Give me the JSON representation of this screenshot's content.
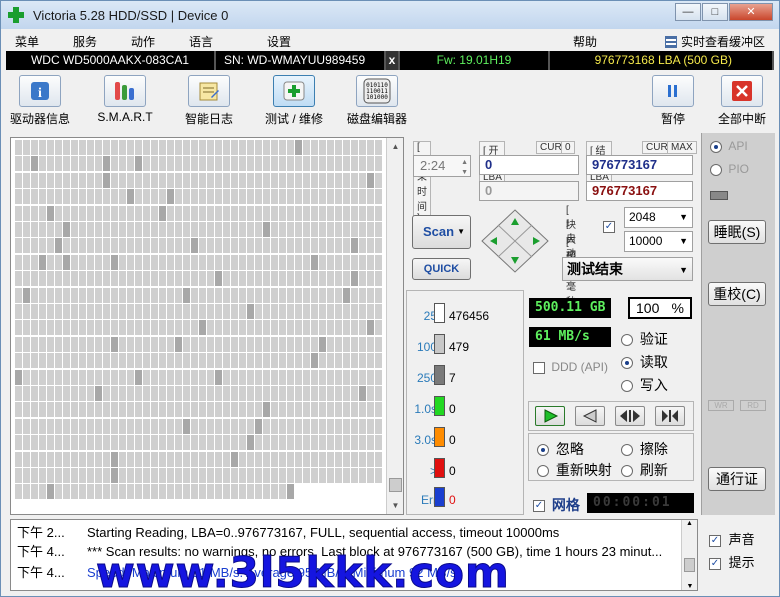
{
  "titlebar": {
    "title": "Victoria 5.28 HDD/SSD | Device 0",
    "min": "—",
    "max": "□",
    "close": "✕"
  },
  "menu": {
    "items": [
      "菜单",
      "服务",
      "动作",
      "语言",
      "设置",
      "帮助"
    ],
    "realtime": "实时查看缓冲区"
  },
  "device": {
    "model": "WDC WD5000AAKX-083CA1",
    "serial": "SN: WD-WMAYUU989459",
    "x": "x",
    "firmware": "Fw: 19.01H19",
    "lba": "976773168 LBA (500 GB)"
  },
  "toolbar": {
    "drivers": "驱动器信息",
    "smart": "S.M.A.R.T",
    "log": "智能日志",
    "test": "测试 / 维修",
    "hex": "磁盘编辑器",
    "pause": "暂停",
    "stop": "全部中断"
  },
  "controls": {
    "end_time_label": "[ 结束时间 ]",
    "end_time": "2:24",
    "start_lba_label": "[ 开始 LBA ]",
    "cur": "CUR",
    "zero": "0",
    "end_lba_label": "[ 结束 LBA ]",
    "max": "MAX",
    "start_lba": "0",
    "end_lba": "976773167",
    "start_lba2": "0",
    "end_lba2": "976773167",
    "scan": "Scan",
    "quick": "QUICK",
    "block_size_label": "[ 块大小 ]",
    "auto_label": "[ 自动 ]",
    "timeout_label": "[ 超时, 毫秒 ]",
    "block_size": "2048",
    "timeout": "10000",
    "status": "测试结束",
    "api": "API",
    "pio": "PIO"
  },
  "stats": [
    {
      "label": "25",
      "count": "476456",
      "color": "#ffffff"
    },
    {
      "label": "100",
      "count": "479",
      "color": "#c8c8c8"
    },
    {
      "label": "250",
      "count": "7",
      "color": "#7a7a7a"
    },
    {
      "label": "1.0s",
      "count": "0",
      "color": "#22d822"
    },
    {
      "label": "3.0s",
      "count": "0",
      "color": "#ff8c00"
    },
    {
      "label": ">",
      "count": "0",
      "color": "#e01010"
    },
    {
      "label": "Err",
      "count": "0",
      "color": "#1a3fd0"
    }
  ],
  "readout": {
    "size": "500.11 GB",
    "percent": "100",
    "pct_sign": "%",
    "speed": "61 MB/s",
    "ddd": "DDD (API)"
  },
  "mode": {
    "verify": "验证",
    "read": "读取",
    "write": "写入"
  },
  "action": {
    "ignore": "忽略",
    "erase": "擦除",
    "remap": "重新映射",
    "refresh": "刷新"
  },
  "bottom": {
    "grid": "网格",
    "timer": "00:00:01"
  },
  "right": {
    "sleep": "睡眠(S)",
    "recal": "重校(C)",
    "wr": "WR",
    "rd": "RD",
    "passport": "通行证",
    "sound": "声音",
    "hint": "提示"
  },
  "log": [
    {
      "time": "下午 2...",
      "msg": "Starting Reading, LBA=0..976773167, FULL, sequential access, timeout 10000ms",
      "color": "#000000"
    },
    {
      "time": "下午 4...",
      "msg": "*** Scan results: no warnings, no errors. Last block at 976773167 (500 GB), time 1 hours 23 minut...",
      "color": "#000000"
    },
    {
      "time": "下午 4...",
      "msg": "Speed: Maximum 61 MB/s. Average 95 MB/s. Minimum 92 MB/s.",
      "color": "#1a3fd0"
    }
  ],
  "watermark": "www.3l5kkk.com",
  "map_cells": "[grid of scanned sectors]"
}
